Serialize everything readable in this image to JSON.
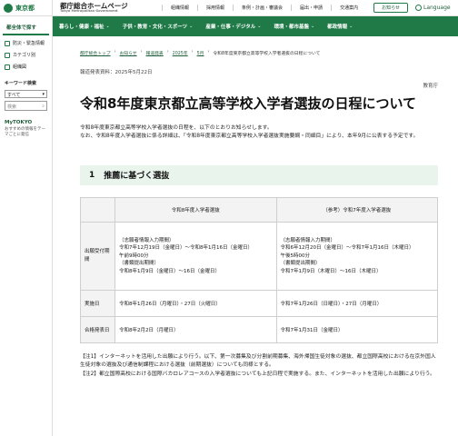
{
  "sidebar": {
    "logo": "東京都",
    "section_title": "都全体で探す",
    "items": [
      {
        "label": "防災・緊急情報"
      },
      {
        "label": "カテゴリ別"
      },
      {
        "label": "組織図"
      }
    ],
    "keyword_label": "キーワード検索",
    "select_value": "すべて",
    "search_placeholder": "検索",
    "mytokyo": "MyTOKYO",
    "mytokyo_sub": "おすすめの情報をテーマごとに発信"
  },
  "header": {
    "title": "都庁総合ホームページ",
    "subtitle": "Tokyo Metropolitan Government",
    "links": [
      "組織情報",
      "採用情報",
      "条例・計画・審議会",
      "届出・申請",
      "交通案内"
    ],
    "notice_button": "お知らせ",
    "language": "Language"
  },
  "nav": {
    "items": [
      "暮らし・健康・福祉",
      "子供・教育・文化・スポーツ",
      "産業・仕事・デジタル",
      "環境・都市基盤",
      "都政情報"
    ]
  },
  "breadcrumb": [
    "都庁総合トップ",
    "お知らせ",
    "報道発表",
    "2025年",
    "5月",
    "令和8年度東京都立高等学校入学者選抜の日程について"
  ],
  "pubdate": "報道発表資料：2025年5月22日",
  "dept": "教育庁",
  "title": "令和8年度東京都立高等学校入学者選抜の日程について",
  "intro": [
    "令和8年度東京都立高等学校入学者選抜の日程を、以下のとおりお知らせします。",
    "なお、令和8年度入学者選抜に係る詳細は、「令和8年度東京都立高等学校入学者選抜実施要綱・同細目」により、本年9月に公表する予定です。"
  ],
  "section": {
    "number": "1",
    "title": "推薦に基づく選抜"
  },
  "table": {
    "headers": [
      "",
      "令和8年度入学者選抜",
      "（参考）令和7年度入学者選抜"
    ],
    "rows": [
      {
        "label": "出願受付期間",
        "col1": [
          "（志願者情報入力期間）",
          "令和7年12月19日（金曜日）～令和8年1月16日（金曜日）",
          "午前9時00分",
          "（書類提出期間）",
          "令和8年1月9日（金曜日）～16日（金曜日）"
        ],
        "col2": [
          "（志願者情報入力期間）",
          "令和6年12月20日（金曜日）～令和7年1月16日（木曜日）",
          "午後5時00分",
          "（書類提出期間）",
          "令和7年1月9日（木曜日）～16日（木曜日）"
        ]
      },
      {
        "label": "実施日",
        "col1": [
          "令和8年1月26日（月曜日）・27日（火曜日）"
        ],
        "col2": [
          "令和7年1月26日（日曜日）・27日（月曜日）"
        ]
      },
      {
        "label": "合格発表日",
        "col1": [
          "令和8年2月2日（月曜日）"
        ],
        "col2": [
          "令和7年1月31日（金曜日）"
        ]
      }
    ]
  },
  "notes": [
    "【注1】インターネットを活用した出願により行う。以下、第一次募集及び分割前期募集、海外帰国生徒対象の選抜、都立国際高校における在京外国人生徒対象の選抜及び通信制課程における選抜（前期選抜）についても同様とする。",
    "【注2】都立国際高校における国際バカロレアコースの入学者選抜についても上記日程で実施する。また、インターネットを活用した出願により行う。"
  ]
}
